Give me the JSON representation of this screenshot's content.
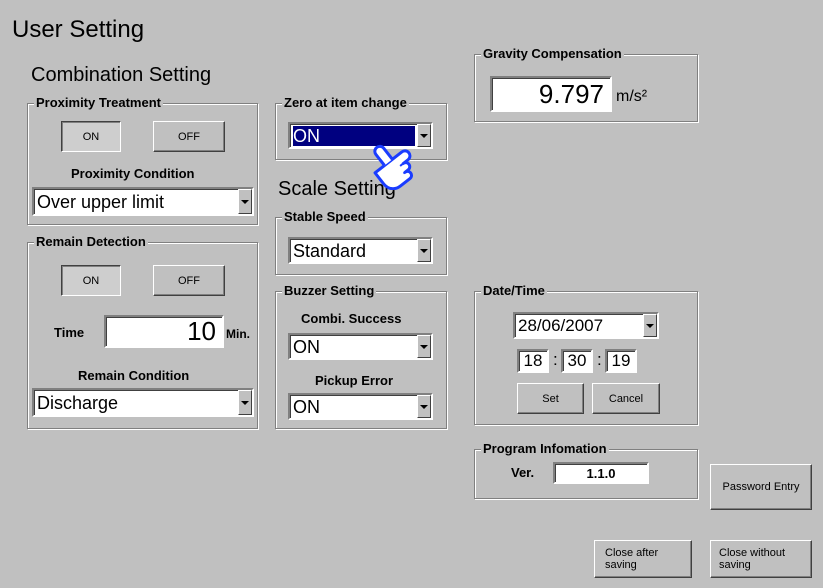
{
  "page": {
    "title": "User Setting"
  },
  "combination": {
    "title": "Combination Setting",
    "proximity": {
      "legend": "Proximity Treatment",
      "on_label": "ON",
      "off_label": "OFF",
      "condition_label": "Proximity Condition",
      "condition_value": "Over upper limit"
    },
    "remain": {
      "legend": "Remain Detection",
      "on_label": "ON",
      "off_label": "OFF",
      "time_label": "Time",
      "time_value": "10",
      "time_unit": "Min.",
      "condition_label": "Remain Condition",
      "condition_value": "Discharge"
    }
  },
  "zero": {
    "legend": "Zero at item change",
    "value": "ON"
  },
  "scale": {
    "title": "Scale Setting",
    "stable_speed": {
      "legend": "Stable Speed",
      "value": "Standard"
    }
  },
  "buzzer": {
    "legend": "Buzzer Setting",
    "combi_label": "Combi. Success",
    "combi_value": "ON",
    "pickup_label": "Pickup Error",
    "pickup_value": "ON"
  },
  "gravity": {
    "legend": "Gravity Compensation",
    "value": "9.797",
    "unit": "m/s²"
  },
  "datetime": {
    "legend": "Date/Time",
    "date": "28/06/2007",
    "hour": "18",
    "minute": "30",
    "second": "19",
    "sep": ":",
    "set_label": "Set",
    "cancel_label": "Cancel"
  },
  "program": {
    "legend": "Program Infomation",
    "ver_label": "Ver.",
    "version": "1.1.0"
  },
  "buttons": {
    "password": "Password Entry",
    "close_save": "Close after saving",
    "close_nosave": "Close without saving"
  },
  "icons": {
    "pointer": "pointing-hand-icon"
  },
  "colors": {
    "background": "#c0c0c0",
    "highlight": "#000080",
    "pointer": "#1a3cff"
  }
}
